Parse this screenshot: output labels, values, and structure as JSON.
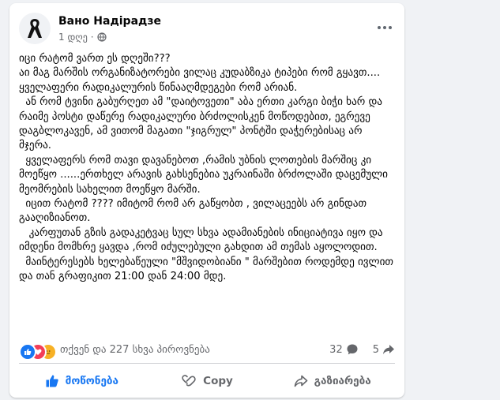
{
  "post": {
    "author": "Вано Надірадзе",
    "time": "1 დღე",
    "separator": "·",
    "privacy_icon": "globe-icon",
    "avatar_icon": "mourning-ribbon-icon",
    "paragraphs": [
      "იცი რატომ ვართ ეს დღეში???\nაი მაგ მარშის ორგანიზატორები ვილაც კუდაბზიკა ტიპები რომ გყავთ.... ყველაფერი რადიკალურის წინააღმდეგები რომ არიან.",
      "  ან რომ ტვინი გაბურღეთ ამ \"დაიტოვეთი\" აბა ერთი კარგი ბიჭი ხარ და რაიმე პოსტი დაწერე რადიკალური ბრძოლისკენ მოწოდებით, ეგრევე დაგბლოკავენ, ამ ვითომ მაგათი \"ჯიგრულ\" პონტში დაჭერებისაც არ მჯერა.",
      "  ყველაფერს რომ თავი დავანებოთ ,რამის უბნის ლოთების მარშიც კი მოეწყო ......ერთხელ არავის გახსენებია უკრაინაში ბრძოლაში დაცემული მეომრების სახელით მოეწყო მარში.",
      "  იცით რატომ ???? იმიტომ რომ არ გაწყობთ , ვილაცეებს არ გინდათ გააღიზიანოთ.",
      "   კარფუთან გზის გადაკეტვაც სულ სხვა ადამიანების ინიციატივა იყო და იმდენი მომხრე ყავდა ,რომ იძულებული გახდით ამ თემას აყოლოდით.",
      "  მაინტერესებს ხელებაწეული \"მშვიდობიანი \" მარშებით როდემდე ივლით და თან გრაფიკით 21:00 დან 24:00 მდე."
    ]
  },
  "stats": {
    "reactions_text": "თქვენ და 227 სხვა პიროვნება",
    "comments_count": "32",
    "shares_count": "5"
  },
  "actions": {
    "like": "მოწონება",
    "copy": "Copy",
    "share": "გაზიარება"
  },
  "colors": {
    "accent": "#1877f2",
    "secondary_text": "#65676b",
    "love": "#f33e58",
    "care": "#f7b125"
  }
}
